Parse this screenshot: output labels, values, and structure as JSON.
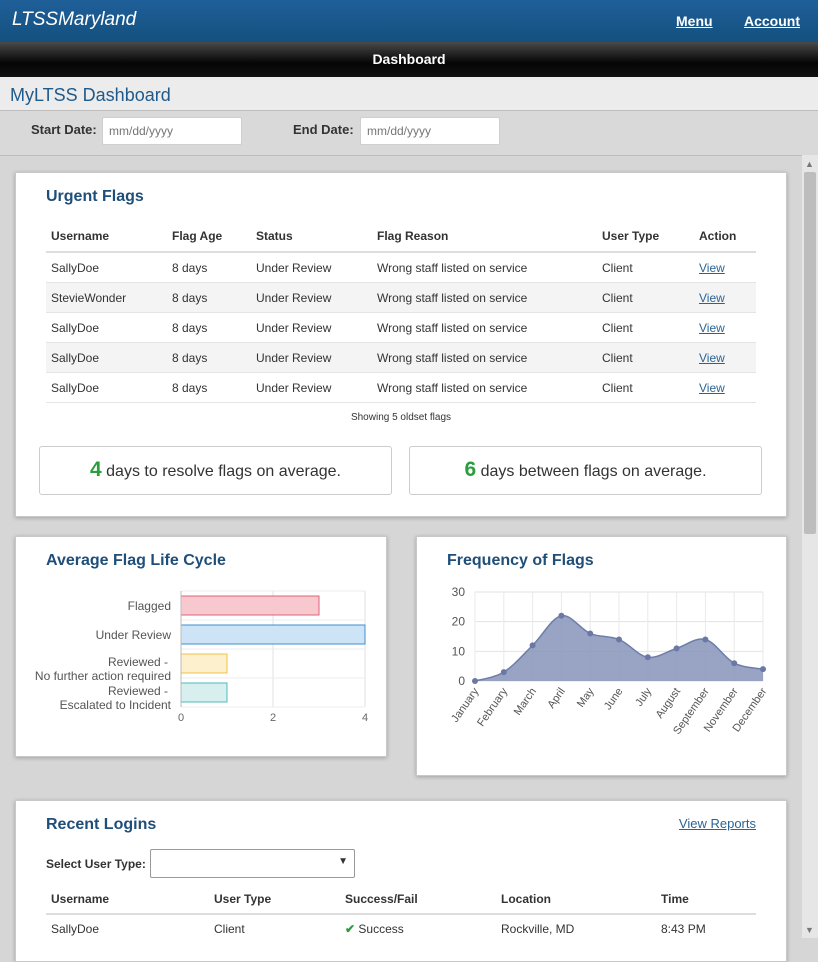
{
  "header": {
    "brand": "LTSSMaryland",
    "menu": "Menu",
    "account": "Account"
  },
  "subbar": {
    "title": "Dashboard"
  },
  "page": {
    "title": "MyLTSS Dashboard"
  },
  "dates": {
    "start_label": "Start Date:",
    "start_placeholder": "mm/dd/yyyy",
    "end_label": "End Date:",
    "end_placeholder": "mm/dd/yyyy"
  },
  "urgent": {
    "title": "Urgent Flags",
    "columns": [
      "Username",
      "Flag Age",
      "Status",
      "Flag Reason",
      "User Type",
      "Action"
    ],
    "rows": [
      [
        "SallyDoe",
        "8 days",
        "Under Review",
        "Wrong staff listed on service",
        "Client",
        "View"
      ],
      [
        "StevieWonder",
        "8 days",
        "Under Review",
        "Wrong staff listed on service",
        "Client",
        "View"
      ],
      [
        "SallyDoe",
        "8 days",
        "Under Review",
        "Wrong staff listed on service",
        "Client",
        "View"
      ],
      [
        "SallyDoe",
        "8 days",
        "Under Review",
        "Wrong staff listed on service",
        "Client",
        "View"
      ],
      [
        "SallyDoe",
        "8 days",
        "Under Review",
        "Wrong staff listed on service",
        "Client",
        "View"
      ]
    ],
    "note": "Showing 5 oldset flags",
    "stat1": {
      "num": "4",
      "text": "days to resolve flags on average."
    },
    "stat2": {
      "num": "6",
      "text": "days between flags on average."
    }
  },
  "lifecycle": {
    "title": "Average Flag Life Cycle"
  },
  "frequency": {
    "title": "Frequency of Flags"
  },
  "logins": {
    "title": "Recent Logins",
    "view_reports": "View Reports",
    "select_label": "Select User Type:",
    "columns": [
      "Username",
      "User Type",
      "Success/Fail",
      "Location",
      "Time"
    ],
    "rows": [
      [
        "SallyDoe",
        "Client",
        "Success",
        "Rockville, MD",
        "8:43 PM"
      ]
    ]
  },
  "chart_data": [
    {
      "type": "bar",
      "orientation": "horizontal",
      "categories": [
        "Flagged",
        "Under Review",
        "Reviewed - No further action required",
        "Reviewed - Escalated to Incident"
      ],
      "values": [
        3,
        4,
        1,
        1
      ],
      "colors": [
        "#f7c9cf",
        "#cde4f7",
        "#fdf0cc",
        "#d7f0ef"
      ],
      "borders": [
        "#e0607a",
        "#3e8ed0",
        "#f2c24a",
        "#4bbcb4"
      ],
      "xlim": [
        0,
        4
      ],
      "xticks": [
        0,
        2,
        4
      ]
    },
    {
      "type": "area",
      "x": [
        "January",
        "February",
        "March",
        "April",
        "May",
        "June",
        "July",
        "August",
        "September",
        "November",
        "December"
      ],
      "values": [
        0,
        3,
        12,
        22,
        16,
        14,
        8,
        11,
        14,
        6,
        4
      ],
      "ylim": [
        0,
        30
      ],
      "yticks": [
        0,
        10,
        20,
        30
      ],
      "fill": "#8794bb",
      "stroke": "#6e7da8"
    }
  ]
}
